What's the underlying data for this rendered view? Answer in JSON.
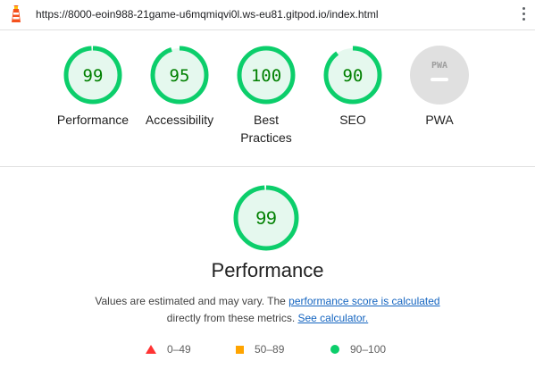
{
  "browser": {
    "url": "https://8000-eoin988-21game-u6mqmiqvi0l.ws-eu81.gitpod.io/index.html"
  },
  "colors": {
    "pass": "#0cce6b",
    "pass_text": "#008000",
    "pass_fill": "#e5f8ee",
    "average": "#ffa400",
    "fail": "#ff3333",
    "na_fill": "#e0e0e0",
    "link": "#1565c0"
  },
  "summary": {
    "gauges": [
      {
        "label": "Performance",
        "score": "99",
        "fraction": 0.99
      },
      {
        "label": "Accessibility",
        "score": "95",
        "fraction": 0.95
      },
      {
        "label": "Best Practices",
        "score": "100",
        "fraction": 1.0
      },
      {
        "label": "SEO",
        "score": "90",
        "fraction": 0.9
      },
      {
        "label": "PWA",
        "badge": "PWA"
      }
    ]
  },
  "detail": {
    "score": "99",
    "fraction": 0.99,
    "title": "Performance",
    "desc_before": "Values are estimated and may vary. The ",
    "desc_link1": "performance score is calculated",
    "desc_middle": "directly from these metrics. ",
    "desc_link2": "See calculator."
  },
  "legend": {
    "fail_range": "0–49",
    "average_range": "50–89",
    "pass_range": "90–100"
  }
}
